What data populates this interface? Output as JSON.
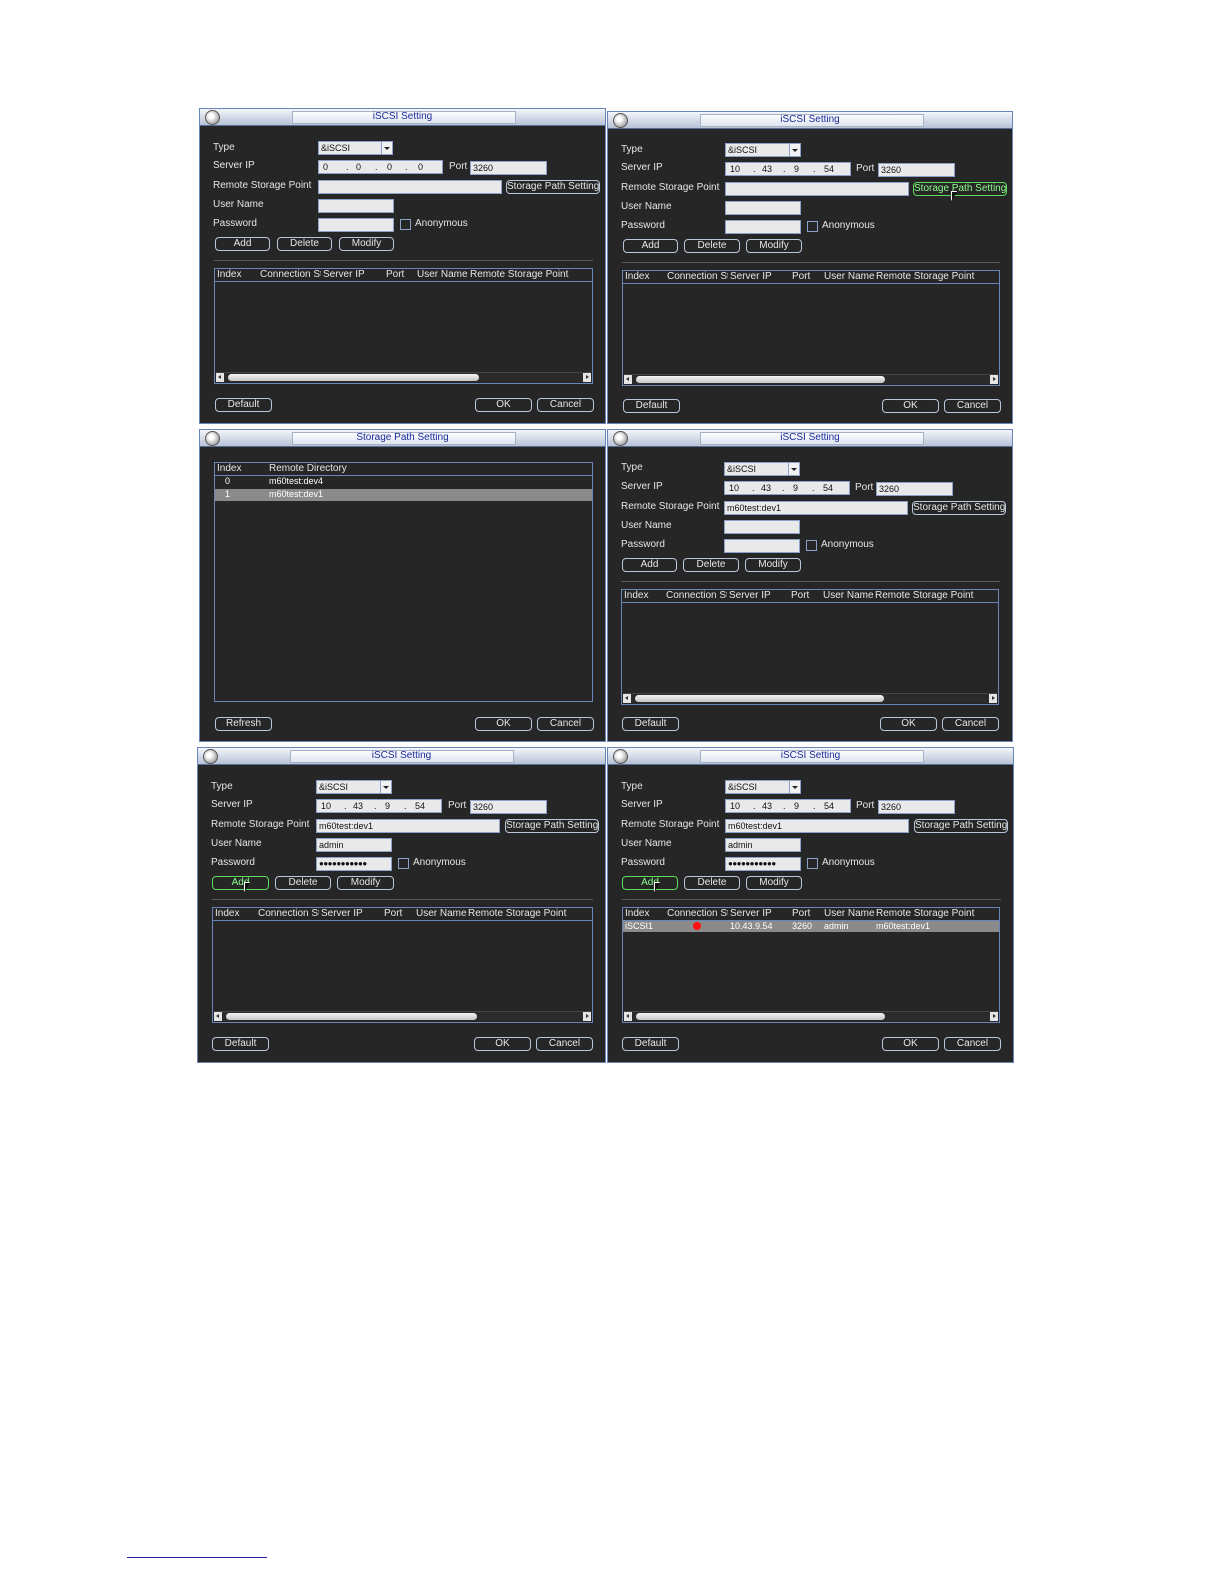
{
  "panel1": {
    "title": "iSCSI Setting",
    "labels": {
      "type": "Type",
      "server_ip": "Server IP",
      "remote": "Remote Storage Point",
      "user": "User Name",
      "password": "Password",
      "port": "Port",
      "anonymous": "Anonymous"
    },
    "type_value": "&iSCSI",
    "ip": [
      "0",
      "0",
      "0",
      "0"
    ],
    "port_value": "3260",
    "remote_value": "",
    "user_value": "",
    "password_value": "",
    "buttons": {
      "storage_path": "Storage Path Setting",
      "add": "Add",
      "delete": "Delete",
      "modify": "Modify",
      "default": "Default",
      "ok": "OK",
      "cancel": "Cancel"
    },
    "columns": [
      "Index",
      "Connection St",
      "Server IP",
      "Port",
      "User Name",
      "Remote Storage Point"
    ]
  },
  "panel2": {
    "title": "iSCSI Setting",
    "labels": {
      "type": "Type",
      "server_ip": "Server IP",
      "remote": "Remote Storage Point",
      "user": "User Name",
      "password": "Password",
      "port": "Port",
      "anonymous": "Anonymous"
    },
    "type_value": "&iSCSI",
    "ip": [
      "10",
      "43",
      "9",
      "54"
    ],
    "port_value": "3260",
    "remote_value": "",
    "user_value": "",
    "password_value": "",
    "buttons": {
      "storage_path": "Storage Path Setting",
      "add": "Add",
      "delete": "Delete",
      "modify": "Modify",
      "default": "Default",
      "ok": "OK",
      "cancel": "Cancel"
    },
    "columns": [
      "Index",
      "Connection St",
      "Server IP",
      "Port",
      "User Name",
      "Remote Storage Point"
    ]
  },
  "panel3": {
    "title": "Storage Path Setting",
    "columns": [
      "Index",
      "Remote Directory"
    ],
    "rows": [
      {
        "index": "0",
        "dir": "m60test:dev4"
      },
      {
        "index": "1",
        "dir": "m60test:dev1"
      }
    ],
    "buttons": {
      "refresh": "Refresh",
      "ok": "OK",
      "cancel": "Cancel"
    }
  },
  "panel4": {
    "title": "iSCSI Setting",
    "labels": {
      "type": "Type",
      "server_ip": "Server IP",
      "remote": "Remote Storage Point",
      "user": "User Name",
      "password": "Password",
      "port": "Port",
      "anonymous": "Anonymous"
    },
    "type_value": "&iSCSI",
    "ip": [
      "10",
      "43",
      "9",
      "54"
    ],
    "port_value": "3260",
    "remote_value": "m60test:dev1",
    "user_value": "",
    "password_value": "",
    "buttons": {
      "storage_path": "Storage Path Setting",
      "add": "Add",
      "delete": "Delete",
      "modify": "Modify",
      "default": "Default",
      "ok": "OK",
      "cancel": "Cancel"
    },
    "columns": [
      "Index",
      "Connection St",
      "Server IP",
      "Port",
      "User Name",
      "Remote Storage Point"
    ]
  },
  "panel5": {
    "title": "iSCSI Setting",
    "labels": {
      "type": "Type",
      "server_ip": "Server IP",
      "remote": "Remote Storage Point",
      "user": "User Name",
      "password": "Password",
      "port": "Port",
      "anonymous": "Anonymous"
    },
    "type_value": "&iSCSI",
    "ip": [
      "10",
      "43",
      "9",
      "54"
    ],
    "port_value": "3260",
    "remote_value": "m60test:dev1",
    "user_value": "admin",
    "password_value": "●●●●●●●●●●●",
    "buttons": {
      "storage_path": "Storage Path Setting",
      "add": "Add",
      "delete": "Delete",
      "modify": "Modify",
      "default": "Default",
      "ok": "OK",
      "cancel": "Cancel"
    },
    "columns": [
      "Index",
      "Connection St",
      "Server IP",
      "Port",
      "User Name",
      "Remote Storage Point"
    ]
  },
  "panel6": {
    "title": "iSCSI Setting",
    "labels": {
      "type": "Type",
      "server_ip": "Server IP",
      "remote": "Remote Storage Point",
      "user": "User Name",
      "password": "Password",
      "port": "Port",
      "anonymous": "Anonymous"
    },
    "type_value": "&iSCSI",
    "ip": [
      "10",
      "43",
      "9",
      "54"
    ],
    "port_value": "3260",
    "remote_value": "m60test:dev1",
    "user_value": "admin",
    "password_value": "●●●●●●●●●●●",
    "buttons": {
      "storage_path": "Storage Path Setting",
      "add": "Add",
      "delete": "Delete",
      "modify": "Modify",
      "default": "Default",
      "ok": "OK",
      "cancel": "Cancel"
    },
    "columns": [
      "Index",
      "Connection St",
      "Server IP",
      "Port",
      "User Name",
      "Remote Storage Point"
    ],
    "row": {
      "index": "iSCSI1",
      "ip": "10.43.9.54",
      "port": "3260",
      "user": "admin",
      "remote": "m60test:dev1"
    },
    "status_color": "#ff1010"
  }
}
